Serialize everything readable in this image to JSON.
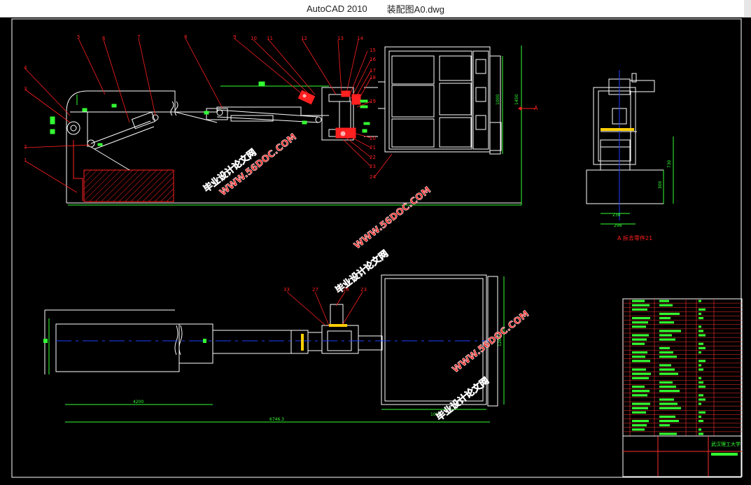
{
  "window": {
    "app_name": "AutoCAD 2010",
    "file_name": "装配图A0.dwg"
  },
  "drawing": {
    "part_numbers_top": [
      "1",
      "2",
      "3",
      "4",
      "5",
      "6",
      "7",
      "8",
      "9",
      "10",
      "11",
      "12",
      "13",
      "14",
      "15",
      "16",
      "17",
      "18",
      "19",
      "20",
      "21",
      "22",
      "23",
      "24"
    ],
    "part_numbers_bottom": [
      "33",
      "27",
      "26",
      "23"
    ],
    "dimensions": {
      "height_main": "1450",
      "height_box": "1000",
      "side_height": "730",
      "side_lower": "300",
      "side_width_inner": "238",
      "side_width_outer": "298",
      "bottom_left": "4200",
      "bottom_total": "6746.3",
      "bottom_right": "1000",
      "bottom_box_height": "1200"
    },
    "view_arrow_label": "A",
    "section_caption": "A 拆去零件21",
    "watermarks": [
      "毕业设计论文网",
      "WWW.56DOC.COM"
    ],
    "title_block_school": "武汉理工大学"
  },
  "colors": {
    "line": "#ffffff",
    "leader": "#ff2020",
    "dimension": "#33ff33",
    "centerline": "#2040ff",
    "hatch": "#ff2020",
    "table": "#ff3030",
    "text_fill": "#33ff33"
  }
}
